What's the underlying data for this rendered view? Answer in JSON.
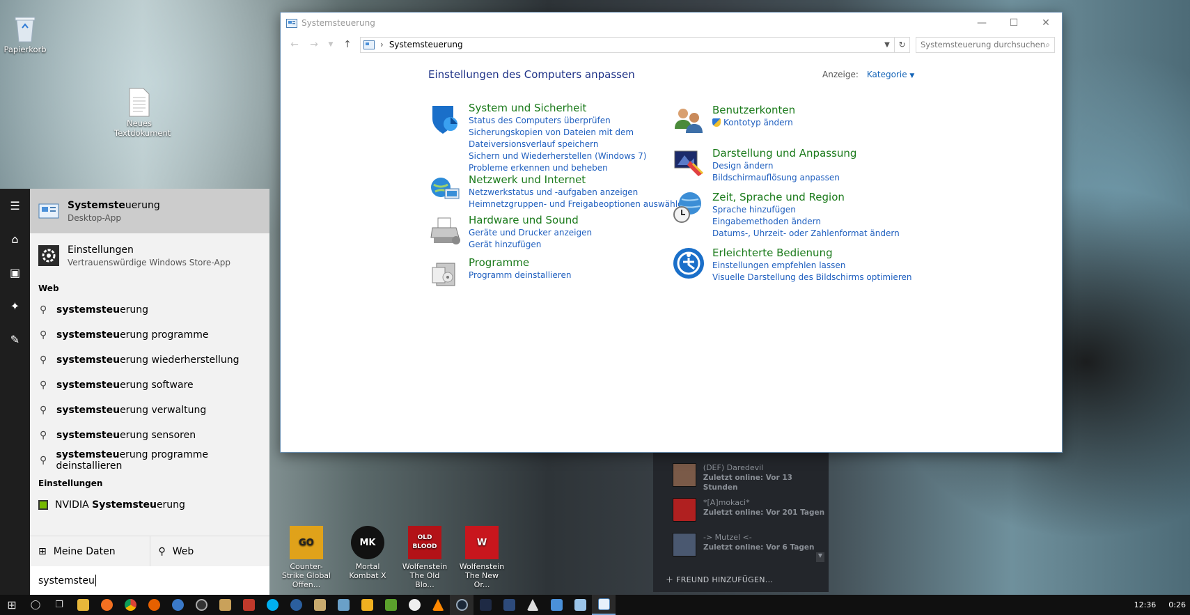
{
  "desktop": {
    "icons": [
      {
        "label": "Papierkorb"
      },
      {
        "label": "Neues Textdokument"
      }
    ],
    "games": [
      {
        "label": "Counter-Strike Global Offen...",
        "badge": "GO"
      },
      {
        "label": "Mortal Kombat X",
        "badge": "MK"
      },
      {
        "label": "Wolfenstein The Old Blo...",
        "badge": "OLD BLOOD"
      },
      {
        "label": "Wolfenstein The New Or...",
        "badge": "W"
      }
    ]
  },
  "window": {
    "title": "Systemsteuerung",
    "address_crumb": "Systemsteuerung",
    "search_placeholder": "Systemsteuerung durchsuchen",
    "heading": "Einstellungen des Computers anpassen",
    "view_label": "Anzeige:",
    "view_value": "Kategorie",
    "categories": [
      {
        "title": "System und Sicherheit",
        "links": [
          "Status des Computers überprüfen",
          "Sicherungskopien von Dateien mit dem",
          "Dateiversionsverlauf speichern",
          "Sichern und Wiederherstellen (Windows 7)",
          "Probleme erkennen und beheben"
        ],
        "color": "#1a6fc9"
      },
      {
        "title": "Netzwerk und Internet",
        "links": [
          "Netzwerkstatus und -aufgaben anzeigen",
          "Heimnetzgruppen- und Freigabeoptionen auswählen"
        ],
        "color": "#2c8bd8"
      },
      {
        "title": "Hardware und Sound",
        "links": [
          "Geräte und Drucker anzeigen",
          "Gerät hinzufügen"
        ],
        "color": "#7a7a7a"
      },
      {
        "title": "Programme",
        "links": [
          "Programm deinstallieren"
        ],
        "color": "#8a8a8a"
      },
      {
        "title": "Benutzerkonten",
        "links": [
          "Kontotyp ändern"
        ],
        "color": "#3d6fa8"
      },
      {
        "title": "Darstellung und Anpassung",
        "links": [
          "Design ändern",
          "Bildschirmauflösung anpassen"
        ],
        "color": "#5a7ac8"
      },
      {
        "title": "Zeit, Sprache und Region",
        "links": [
          "Sprache hinzufügen",
          "Eingabemethoden ändern",
          "Datums-, Uhrzeit- oder Zahlenformat ändern"
        ],
        "color": "#3c8ed6"
      },
      {
        "title": "Erleichterte Bedienung",
        "links": [
          "Einstellungen empfehlen lassen",
          "Visuelle Darstellung des Bildschirms optimieren"
        ],
        "color": "#1a6fc9"
      }
    ]
  },
  "steam": {
    "friends": [
      {
        "name": "(DEF) Daredevil",
        "status": "Zuletzt online: Vor 13 Stunden"
      },
      {
        "name": "*[A]mokaci*",
        "status": "Zuletzt online: Vor 201 Tagen"
      },
      {
        "name": "-> Mutzel <-",
        "status": "Zuletzt online: Vor 6 Tagen"
      }
    ],
    "add_friend": "FREUND HINZUFÜGEN..."
  },
  "start": {
    "best_match": {
      "name_bold": "Systemste",
      "name_rest": "uerung",
      "sub": "Desktop-App"
    },
    "second": {
      "name": "Einstellungen",
      "sub": "Vertrauenswürdige Windows Store-App"
    },
    "web_header": "Web",
    "suggestions": [
      {
        "bold": "systemsteu",
        "rest": "erung"
      },
      {
        "bold": "systemsteu",
        "rest": "erung programme"
      },
      {
        "bold": "systemsteu",
        "rest": "erung wiederherstellung"
      },
      {
        "bold": "systemsteu",
        "rest": "erung software"
      },
      {
        "bold": "systemsteu",
        "rest": "erung verwaltung"
      },
      {
        "bold": "systemsteu",
        "rest": "erung sensoren"
      },
      {
        "bold": "systemsteu",
        "rest": "erung programme deinstallieren"
      }
    ],
    "settings_header": "Einstellungen",
    "nvidia": {
      "pre": "NVIDIA ",
      "bold": "Systemsteu",
      "rest": "erung"
    },
    "tab_mydata": "Meine Daten",
    "tab_web": "Web",
    "query": "systemsteu"
  },
  "taskbar": {
    "clock_time": "12:36",
    "clock_line2": "0:26"
  }
}
